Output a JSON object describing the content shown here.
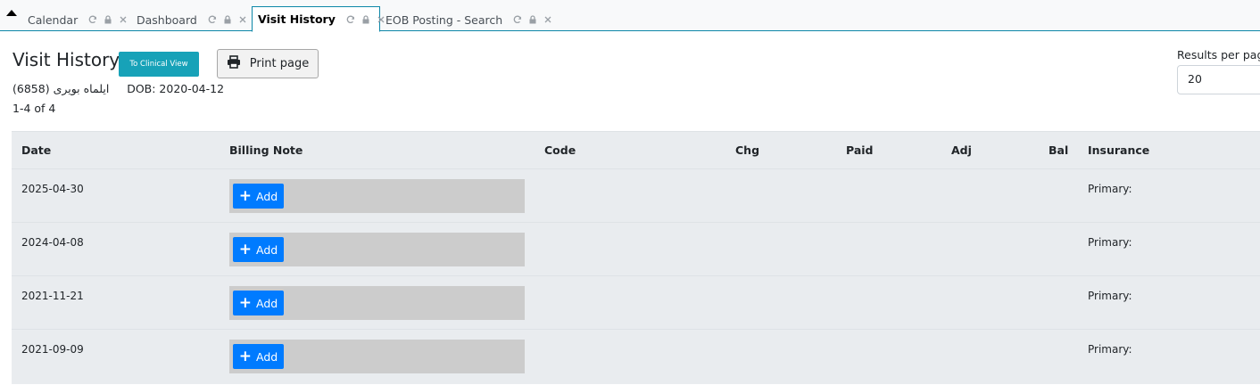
{
  "tabs": [
    {
      "label": "Calendar",
      "active": false
    },
    {
      "label": "Dashboard",
      "active": false
    },
    {
      "label": "Visit History",
      "active": true
    },
    {
      "label": "EOB Posting - Search",
      "active": false
    }
  ],
  "header": {
    "title": "Visit History",
    "clinical_view_label": "To Clinical View",
    "print_label": "Print page",
    "patient_name": "ایلماه بویری",
    "patient_id": "(6858)",
    "dob": "DOB: 2020-04-12",
    "range": "1-4 of 4"
  },
  "results_per_page": {
    "label": "Results per page",
    "value": "20"
  },
  "table": {
    "columns": [
      "Date",
      "Billing Note",
      "Code",
      "Chg",
      "Paid",
      "Adj",
      "Bal",
      "Insurance"
    ],
    "rows": [
      {
        "date": "2025-04-30",
        "add_label": "Add",
        "insurance": "Primary:"
      },
      {
        "date": "2024-04-08",
        "add_label": "Add",
        "insurance": "Primary:"
      },
      {
        "date": "2021-11-21",
        "add_label": "Add",
        "insurance": "Primary:"
      },
      {
        "date": "2021-09-09",
        "add_label": "Add",
        "insurance": "Primary:"
      }
    ]
  },
  "colors": {
    "accent_teal": "#17a2b8",
    "primary_blue": "#007bff",
    "table_bg": "#e9ecef",
    "note_bg": "#cccccc"
  }
}
